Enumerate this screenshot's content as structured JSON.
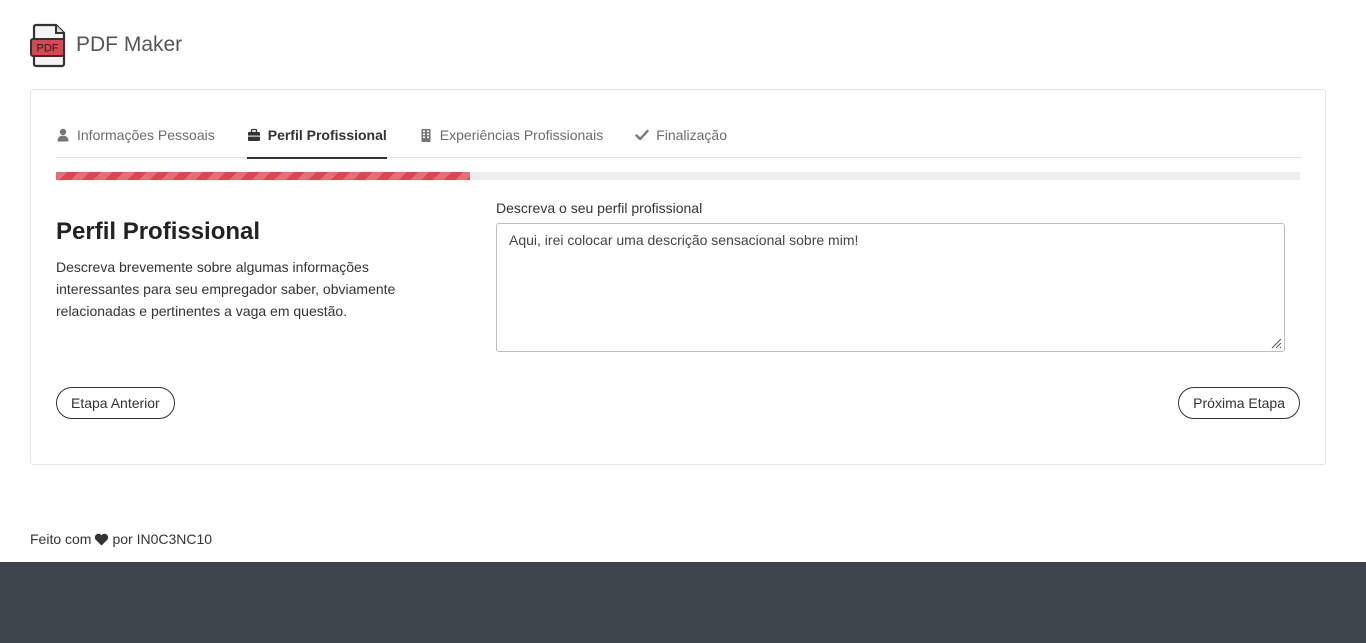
{
  "app": {
    "title": "PDF Maker",
    "logo_icon": "pdf-file-icon",
    "logo_badge": "PDF",
    "accent_color": "#dc4650"
  },
  "tabs": [
    {
      "label": "Informações Pessoais",
      "icon": "user-icon",
      "active": false
    },
    {
      "label": "Perfil Profissional",
      "icon": "briefcase-icon",
      "active": true
    },
    {
      "label": "Experiências Profissionais",
      "icon": "building-icon",
      "active": false
    },
    {
      "label": "Finalização",
      "icon": "check-icon",
      "active": false
    }
  ],
  "progress": {
    "fraction": 0.333
  },
  "section": {
    "title": "Perfil Profissional",
    "description": "Descreva brevemente sobre algumas informações interessantes para seu empregador saber, obviamente relacionadas e pertinentes a vaga em questão."
  },
  "form": {
    "label": "Descreva o seu perfil profissional",
    "value": "Aqui, irei colocar uma descrição sensacional sobre mim!"
  },
  "buttons": {
    "prev": "Etapa Anterior",
    "next": "Próxima Etapa"
  },
  "footer": {
    "prefix": "Feito com",
    "suffix": "por IN0C3NC10",
    "heart_icon": "heart-icon"
  }
}
